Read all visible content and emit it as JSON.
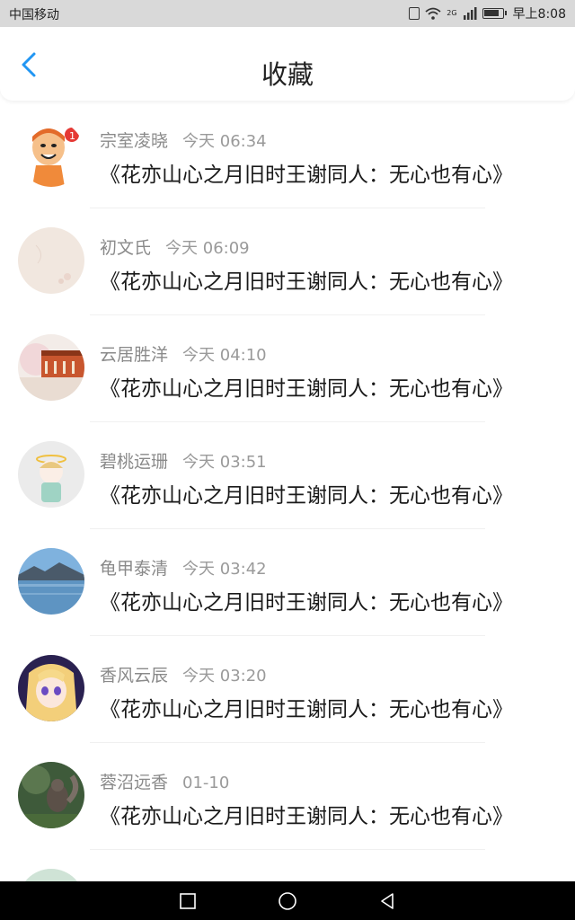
{
  "status_bar": {
    "carrier": "中国移动",
    "time": "早上8:08",
    "network": "2G"
  },
  "header": {
    "title": "收藏"
  },
  "favorites": [
    {
      "name": "宗室凌晓",
      "time": "今天 06:34",
      "book": "《花亦山心之月旧时王谢同人：无心也有心》",
      "avatar": "cartoon-avatar"
    },
    {
      "name": "初文氏",
      "time": "今天 06:09",
      "book": "《花亦山心之月旧时王谢同人：无心也有心》",
      "avatar": "floral-avatar"
    },
    {
      "name": "云居胜洋",
      "time": "今天 04:10",
      "book": "《花亦山心之月旧时王谢同人：无心也有心》",
      "avatar": "temple-avatar"
    },
    {
      "name": "碧桃运珊",
      "time": "今天 03:51",
      "book": "《花亦山心之月旧时王谢同人：无心也有心》",
      "avatar": "chibi-avatar"
    },
    {
      "name": "龟甲泰清",
      "time": "今天 03:42",
      "book": "《花亦山心之月旧时王谢同人：无心也有心》",
      "avatar": "lake-avatar"
    },
    {
      "name": "香风云辰",
      "time": "今天 03:20",
      "book": "《花亦山心之月旧时王谢同人：无心也有心》",
      "avatar": "anime-avatar"
    },
    {
      "name": "蓉沼远香",
      "time": "01-10",
      "book": "《花亦山心之月旧时王谢同人：无心也有心》",
      "avatar": "squirrel-avatar"
    }
  ],
  "colors": {
    "accent": "#2196f3",
    "muted_text": "#8a8a8a",
    "status_bar_bg": "#d9d9d9"
  },
  "nav_icons": [
    "recent-apps-icon",
    "home-icon",
    "back-icon"
  ]
}
